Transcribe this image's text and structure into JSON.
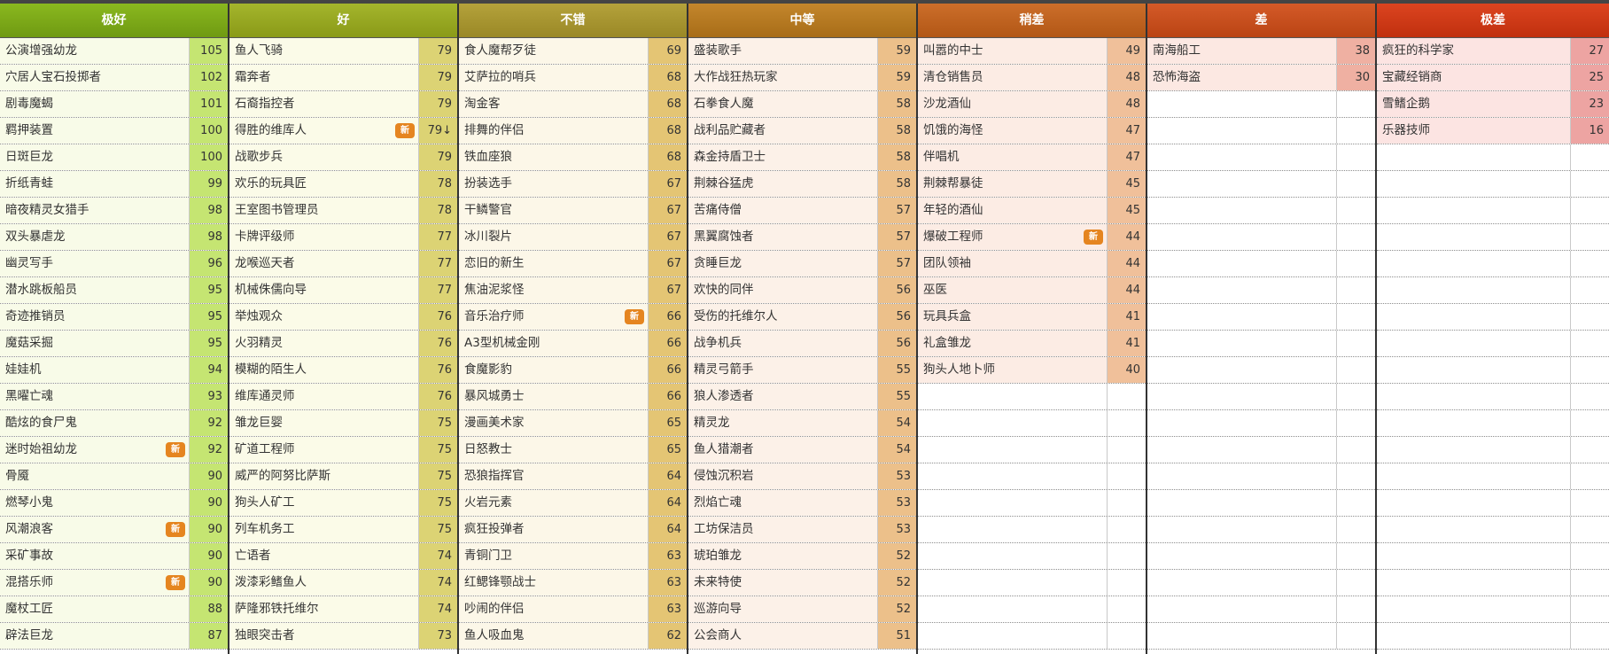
{
  "new_badge": "新",
  "columns": [
    {
      "title": "极好",
      "header_color": "#8ab81f",
      "header_dark": "#6f9a12",
      "row_bg": "#f8fbe8",
      "score_bg": "#c5e572",
      "items": [
        {
          "name": "公演增强幼龙",
          "score": "105",
          "new": false
        },
        {
          "name": "穴居人宝石投掷者",
          "score": "102",
          "new": false
        },
        {
          "name": "剧毒魔蝎",
          "score": "101",
          "new": false
        },
        {
          "name": "羁押装置",
          "score": "100",
          "new": false
        },
        {
          "name": "日斑巨龙",
          "score": "100",
          "new": false
        },
        {
          "name": "折纸青蛙",
          "score": "99",
          "new": false
        },
        {
          "name": "暗夜精灵女猎手",
          "score": "98",
          "new": false
        },
        {
          "name": "双头暴虐龙",
          "score": "98",
          "new": false
        },
        {
          "name": "幽灵写手",
          "score": "96",
          "new": false
        },
        {
          "name": "潜水跳板船员",
          "score": "95",
          "new": false
        },
        {
          "name": "奇迹推销员",
          "score": "95",
          "new": false
        },
        {
          "name": "魔菇采掘",
          "score": "95",
          "new": false
        },
        {
          "name": "娃娃机",
          "score": "94",
          "new": false
        },
        {
          "name": "黑曜亡魂",
          "score": "93",
          "new": false
        },
        {
          "name": "酷炫的食尸鬼",
          "score": "92",
          "new": false
        },
        {
          "name": "迷时始祖幼龙",
          "score": "92",
          "new": true
        },
        {
          "name": "骨魇",
          "score": "90",
          "new": false
        },
        {
          "name": "燃琴小鬼",
          "score": "90",
          "new": false
        },
        {
          "name": "风潮浪客",
          "score": "90",
          "new": true
        },
        {
          "name": "采矿事故",
          "score": "90",
          "new": false
        },
        {
          "name": "混搭乐师",
          "score": "90",
          "new": true
        },
        {
          "name": "魔杖工匠",
          "score": "88",
          "new": false
        },
        {
          "name": "辟法巨龙",
          "score": "87",
          "new": false
        }
      ]
    },
    {
      "title": "好",
      "header_color": "#a4b52c",
      "header_dark": "#8a9a18",
      "row_bg": "#fbfbe8",
      "score_bg": "#dcd374",
      "items": [
        {
          "name": "鱼人飞骑",
          "score": "79",
          "new": false
        },
        {
          "name": "霜奔者",
          "score": "79",
          "new": false
        },
        {
          "name": "石裔指控者",
          "score": "79",
          "new": false
        },
        {
          "name": "得胜的维库人",
          "score": "79↓",
          "new": true
        },
        {
          "name": "战歌步兵",
          "score": "79",
          "new": false
        },
        {
          "name": "欢乐的玩具匠",
          "score": "78",
          "new": false
        },
        {
          "name": "王室图书管理员",
          "score": "78",
          "new": false
        },
        {
          "name": "卡牌评级师",
          "score": "77",
          "new": false
        },
        {
          "name": "龙喉巡天者",
          "score": "77",
          "new": false
        },
        {
          "name": "机械侏儒向导",
          "score": "77",
          "new": false
        },
        {
          "name": "举烛观众",
          "score": "76",
          "new": false
        },
        {
          "name": "火羽精灵",
          "score": "76",
          "new": false
        },
        {
          "name": "模糊的陌生人",
          "score": "76",
          "new": false
        },
        {
          "name": "维库通灵师",
          "score": "76",
          "new": false
        },
        {
          "name": "雏龙巨婴",
          "score": "75",
          "new": false
        },
        {
          "name": "矿道工程师",
          "score": "75",
          "new": false
        },
        {
          "name": "威严的阿努比萨斯",
          "score": "75",
          "new": false
        },
        {
          "name": "狗头人矿工",
          "score": "75",
          "new": false
        },
        {
          "name": "列车机务工",
          "score": "75",
          "new": false
        },
        {
          "name": "亡语者",
          "score": "74",
          "new": false
        },
        {
          "name": "泼漆彩鳍鱼人",
          "score": "74",
          "new": false
        },
        {
          "name": "萨隆邪铁托维尔",
          "score": "74",
          "new": false
        },
        {
          "name": "独眼突击者",
          "score": "73",
          "new": false
        }
      ]
    },
    {
      "title": "不错",
      "header_color": "#b4a23b",
      "header_dark": "#9a8826",
      "row_bg": "#fcf7e8",
      "score_bg": "#e4c574",
      "items": [
        {
          "name": "食人魔帮歹徒",
          "score": "69",
          "new": false
        },
        {
          "name": "艾萨拉的哨兵",
          "score": "68",
          "new": false
        },
        {
          "name": "淘金客",
          "score": "68",
          "new": false
        },
        {
          "name": "排舞的伴侣",
          "score": "68",
          "new": false
        },
        {
          "name": "铁血座狼",
          "score": "68",
          "new": false
        },
        {
          "name": "扮装选手",
          "score": "67",
          "new": false
        },
        {
          "name": "干鳞警官",
          "score": "67",
          "new": false
        },
        {
          "name": "冰川裂片",
          "score": "67",
          "new": false
        },
        {
          "name": "恋旧的新生",
          "score": "67",
          "new": false
        },
        {
          "name": "焦油泥浆怪",
          "score": "67",
          "new": false
        },
        {
          "name": "音乐治疗师",
          "score": "66",
          "new": true
        },
        {
          "name": "A3型机械金刚",
          "score": "66",
          "new": false
        },
        {
          "name": "食魔影豹",
          "score": "66",
          "new": false
        },
        {
          "name": "暴风城勇士",
          "score": "66",
          "new": false
        },
        {
          "name": "漫画美术家",
          "score": "65",
          "new": false
        },
        {
          "name": "日怒教士",
          "score": "65",
          "new": false
        },
        {
          "name": "恐狼指挥官",
          "score": "64",
          "new": false
        },
        {
          "name": "火岩元素",
          "score": "64",
          "new": false
        },
        {
          "name": "疯狂投弹者",
          "score": "64",
          "new": false
        },
        {
          "name": "青铜门卫",
          "score": "63",
          "new": false
        },
        {
          "name": "红鳃锋颚战士",
          "score": "63",
          "new": false
        },
        {
          "name": "吵闹的伴侣",
          "score": "63",
          "new": false
        },
        {
          "name": "鱼人吸血鬼",
          "score": "62",
          "new": false
        }
      ]
    },
    {
      "title": "中等",
      "header_color": "#c3862c",
      "header_dark": "#a86d18",
      "row_bg": "#fcf1e8",
      "score_bg": "#ecc08a",
      "items": [
        {
          "name": "盛装歌手",
          "score": "59",
          "new": false
        },
        {
          "name": "大作战狂热玩家",
          "score": "59",
          "new": false
        },
        {
          "name": "石拳食人魔",
          "score": "58",
          "new": false
        },
        {
          "name": "战利品贮藏者",
          "score": "58",
          "new": false
        },
        {
          "name": "森金持盾卫士",
          "score": "58",
          "new": false
        },
        {
          "name": "荆棘谷猛虎",
          "score": "58",
          "new": false
        },
        {
          "name": "苦痛侍僧",
          "score": "57",
          "new": false
        },
        {
          "name": "黑翼腐蚀者",
          "score": "57",
          "new": false
        },
        {
          "name": "贪睡巨龙",
          "score": "57",
          "new": false
        },
        {
          "name": "欢快的同伴",
          "score": "56",
          "new": false
        },
        {
          "name": "受伤的托维尔人",
          "score": "56",
          "new": false
        },
        {
          "name": "战争机兵",
          "score": "56",
          "new": false
        },
        {
          "name": "精灵弓箭手",
          "score": "55",
          "new": false
        },
        {
          "name": "狼人渗透者",
          "score": "55",
          "new": false
        },
        {
          "name": "精灵龙",
          "score": "54",
          "new": false
        },
        {
          "name": "鱼人猎潮者",
          "score": "54",
          "new": false
        },
        {
          "name": "侵蚀沉积岩",
          "score": "53",
          "new": false
        },
        {
          "name": "烈焰亡魂",
          "score": "53",
          "new": false
        },
        {
          "name": "工坊保洁员",
          "score": "53",
          "new": false
        },
        {
          "name": "琥珀雏龙",
          "score": "52",
          "new": false
        },
        {
          "name": "未来特使",
          "score": "52",
          "new": false
        },
        {
          "name": "巡游向导",
          "score": "52",
          "new": false
        },
        {
          "name": "公会商人",
          "score": "51",
          "new": false
        }
      ]
    },
    {
      "title": "稍差",
      "header_color": "#cc6e2a",
      "header_dark": "#b25716",
      "row_bg": "#fcece4",
      "score_bg": "#f0c09a",
      "items": [
        {
          "name": "叫嚣的中士",
          "score": "49",
          "new": false
        },
        {
          "name": "清仓销售员",
          "score": "48",
          "new": false
        },
        {
          "name": "沙龙酒仙",
          "score": "48",
          "new": false
        },
        {
          "name": "饥饿的海怪",
          "score": "47",
          "new": false
        },
        {
          "name": "伴唱机",
          "score": "47",
          "new": false
        },
        {
          "name": "荆棘帮暴徒",
          "score": "45",
          "new": false
        },
        {
          "name": "年轻的酒仙",
          "score": "45",
          "new": false
        },
        {
          "name": "爆破工程师",
          "score": "44",
          "new": true
        },
        {
          "name": "团队领袖",
          "score": "44",
          "new": false
        },
        {
          "name": "巫医",
          "score": "44",
          "new": false
        },
        {
          "name": "玩具兵盒",
          "score": "41",
          "new": false
        },
        {
          "name": "礼盒雏龙",
          "score": "41",
          "new": false
        },
        {
          "name": "狗头人地卜师",
          "score": "40",
          "new": false
        }
      ]
    },
    {
      "title": "差",
      "header_color": "#d45a28",
      "header_dark": "#ba4414",
      "row_bg": "#fce8e2",
      "score_bg": "#efb0a2",
      "items": [
        {
          "name": "南海船工",
          "score": "38",
          "new": false
        },
        {
          "name": "恐怖海盗",
          "score": "30",
          "new": false
        }
      ]
    },
    {
      "title": "极差",
      "header_color": "#dc4420",
      "header_dark": "#c0300e",
      "row_bg": "#fce4e2",
      "score_bg": "#eda4a2",
      "items": [
        {
          "name": "疯狂的科学家",
          "score": "27",
          "new": false
        },
        {
          "name": "宝藏经销商",
          "score": "25",
          "new": false
        },
        {
          "name": "雪鳍企鹅",
          "score": "23",
          "new": false
        },
        {
          "name": "乐器技师",
          "score": "16",
          "new": false
        }
      ]
    }
  ]
}
